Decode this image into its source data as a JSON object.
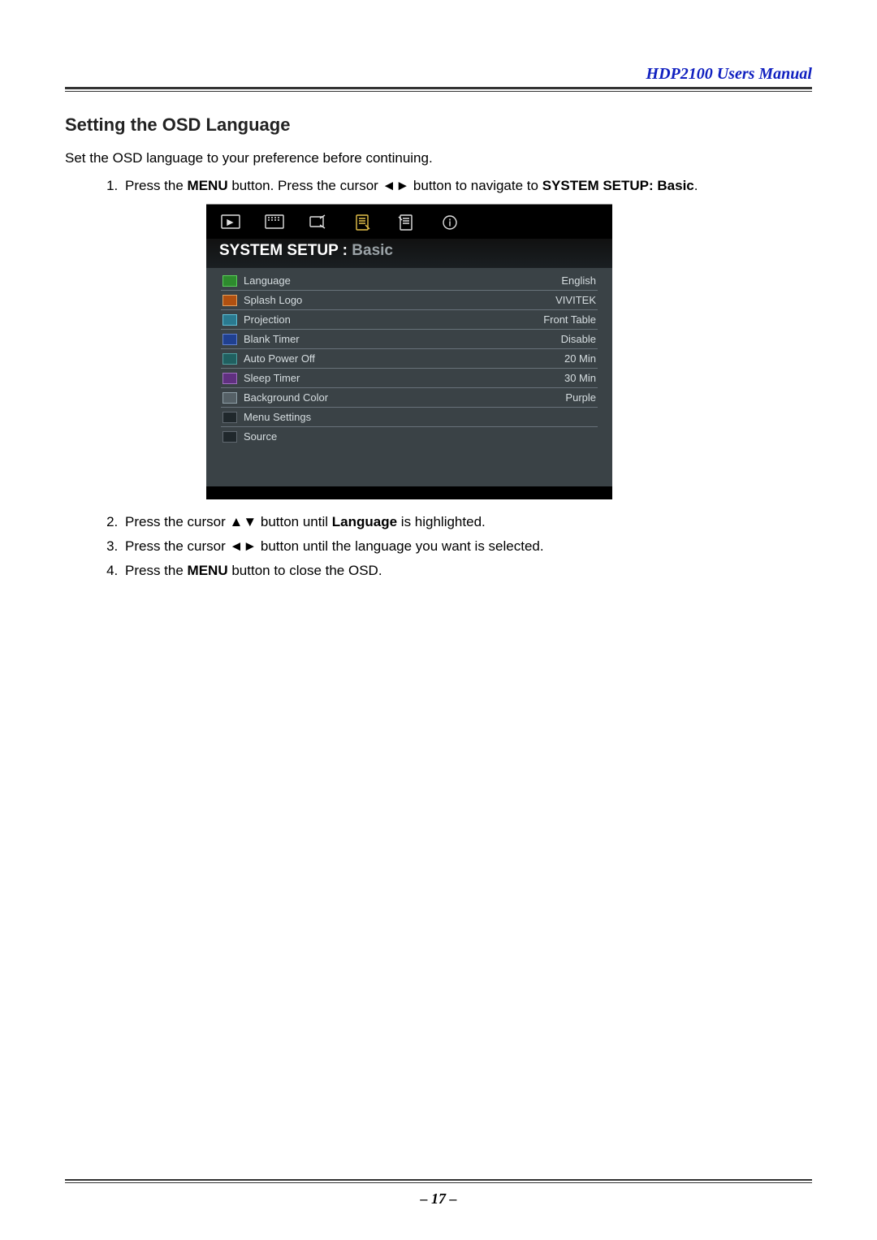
{
  "header": {
    "title": "HDP2100 Users Manual"
  },
  "section": {
    "heading": "Setting the OSD Language",
    "intro": "Set the OSD language to your preference before continuing."
  },
  "steps": {
    "s1a": "Press the ",
    "s1b": "MENU",
    "s1c": " button. Press the cursor ◄► button to navigate to ",
    "s1d": "SYSTEM SETUP: Basic",
    "s1e": ".",
    "s2a": "Press the cursor ▲▼ button until ",
    "s2b": "Language",
    "s2c": " is highlighted.",
    "s3": "Press the cursor ◄► button until the language you want is selected.",
    "s4a": "Press the ",
    "s4b": "MENU",
    "s4c": " button to close the OSD."
  },
  "osd": {
    "title_a": "SYSTEM SETUP : ",
    "title_b": "Basic",
    "rows": [
      {
        "label": "Language",
        "value": "English",
        "iconClass": "green"
      },
      {
        "label": "Splash Logo",
        "value": "VIVITEK",
        "iconClass": "orange"
      },
      {
        "label": "Projection",
        "value": "Front Table",
        "iconClass": "cyan"
      },
      {
        "label": "Blank Timer",
        "value": "Disable",
        "iconClass": "blue"
      },
      {
        "label": "Auto Power Off",
        "value": "20 Min",
        "iconClass": "teal"
      },
      {
        "label": "Sleep Timer",
        "value": "30 Min",
        "iconClass": "purple"
      },
      {
        "label": "Background Color",
        "value": "Purple",
        "iconClass": "gray"
      },
      {
        "label": "Menu Settings",
        "value": "",
        "iconClass": "dark"
      },
      {
        "label": "Source",
        "value": "",
        "iconClass": "dark"
      }
    ]
  },
  "footer": {
    "page": "– 17 –"
  }
}
